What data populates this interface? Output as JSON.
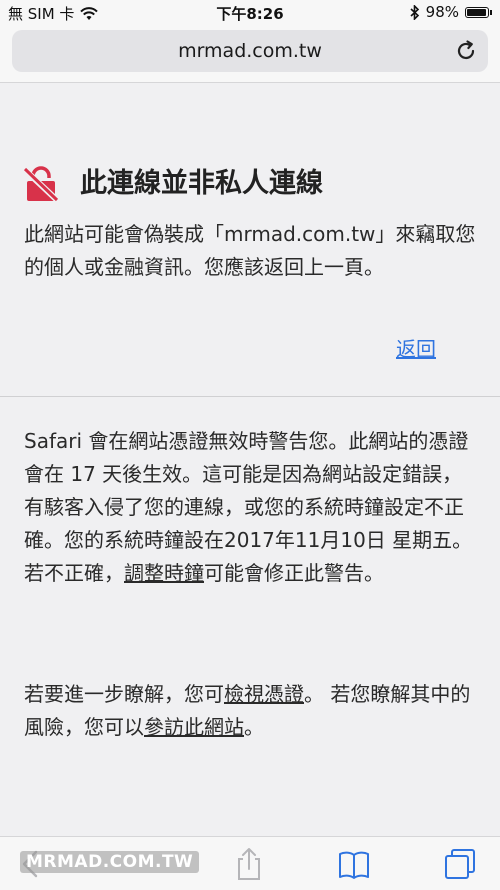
{
  "status_bar": {
    "carrier": "無 SIM 卡",
    "time": "下午8:26",
    "battery": "98%",
    "battery_level": 0.98
  },
  "nav_bar": {
    "url": "mrmad.com.tw"
  },
  "warning": {
    "title": "此連線並非私人連線",
    "body": "此網站可能會偽裝成「mrmad.com.tw」來竊取您的個人或金融資訊。您應該返回上一頁。",
    "back_label": "返回"
  },
  "details": {
    "p1_text_before": "Safari 會在網站憑證無效時警告您。此網站的憑證會在 17 天後生效。這可能是因為網站設定錯誤，有駭客入侵了您的連線，或您的系統時鐘設定不正確。您的系統時鐘設在2017年11月10日 星期五。若不正確，",
    "adjust_clock_link": "調整時鐘",
    "p1_text_after": "可能會修正此警告。",
    "p2_text_before": "若要進一步瞭解，您可",
    "view_cert_link": "檢視憑證",
    "p2_text_middle": "。 若您瞭解其中的風險，您可以",
    "visit_site_link": "參訪此網站",
    "p2_text_after": "。"
  },
  "watermark": "MRMAD.COM.TW",
  "colors": {
    "accent": "#2f74e0",
    "warning_icon": "#d8324a"
  },
  "icons": {
    "reload": "reload-icon",
    "wifi": "wifi-icon",
    "bluetooth": "bluetooth-icon",
    "lock_warning": "broken-lock-icon",
    "back": "chevron-left-icon",
    "share": "share-icon",
    "bookmarks": "book-icon",
    "tabs": "tabs-icon"
  }
}
